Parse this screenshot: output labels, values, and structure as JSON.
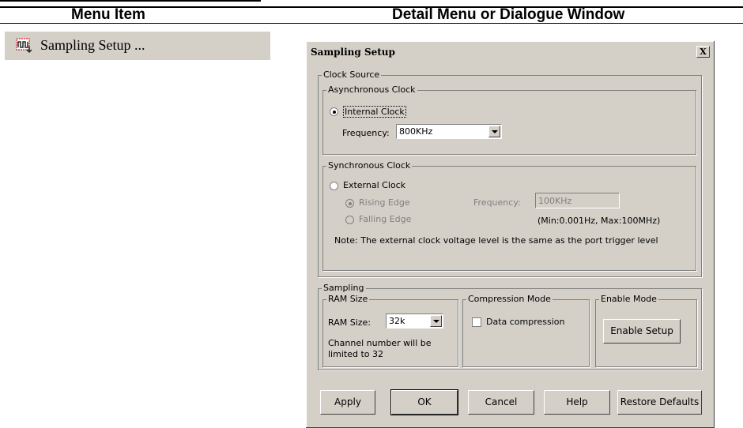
{
  "table_header": {
    "col1": "Menu Item",
    "col2": "Detail Menu or Dialogue Window"
  },
  "menu_item": {
    "label": "Sampling Setup ...",
    "icon": "sampling-setup-icon"
  },
  "dialog": {
    "title": "Sampling Setup",
    "close_label": "X",
    "clock_source": {
      "legend": "Clock Source",
      "async": {
        "legend": "Asynchronous Clock",
        "internal_label": "Internal Clock",
        "internal_selected": true,
        "freq_label": "Frequency:",
        "freq_value": "800KHz"
      },
      "sync": {
        "legend": "Synchronous Clock",
        "external_label": "External Clock",
        "external_selected": false,
        "rising_label": "Rising Edge",
        "falling_label": "Falling Edge",
        "freq_label": "Frequency:",
        "freq_value": "100KHz",
        "range": "(Min:0.001Hz, Max:100MHz)",
        "note": "Note: The external clock voltage level is the same as the port trigger level"
      }
    },
    "sampling": {
      "legend": "Sampling",
      "ram": {
        "legend": "RAM Size",
        "label": "RAM Size:",
        "value": "32k",
        "note_line1": "Channel number will be",
        "note_line2": "limited to 32"
      },
      "compression": {
        "legend": "Compression Mode",
        "checkbox_label": "Data compression",
        "checked": false
      },
      "enable": {
        "legend": "Enable Mode",
        "button": "Enable Setup"
      }
    },
    "buttons": {
      "apply": "Apply",
      "ok": "OK",
      "cancel": "Cancel",
      "help": "Help",
      "restore": "Restore Defaults"
    }
  }
}
